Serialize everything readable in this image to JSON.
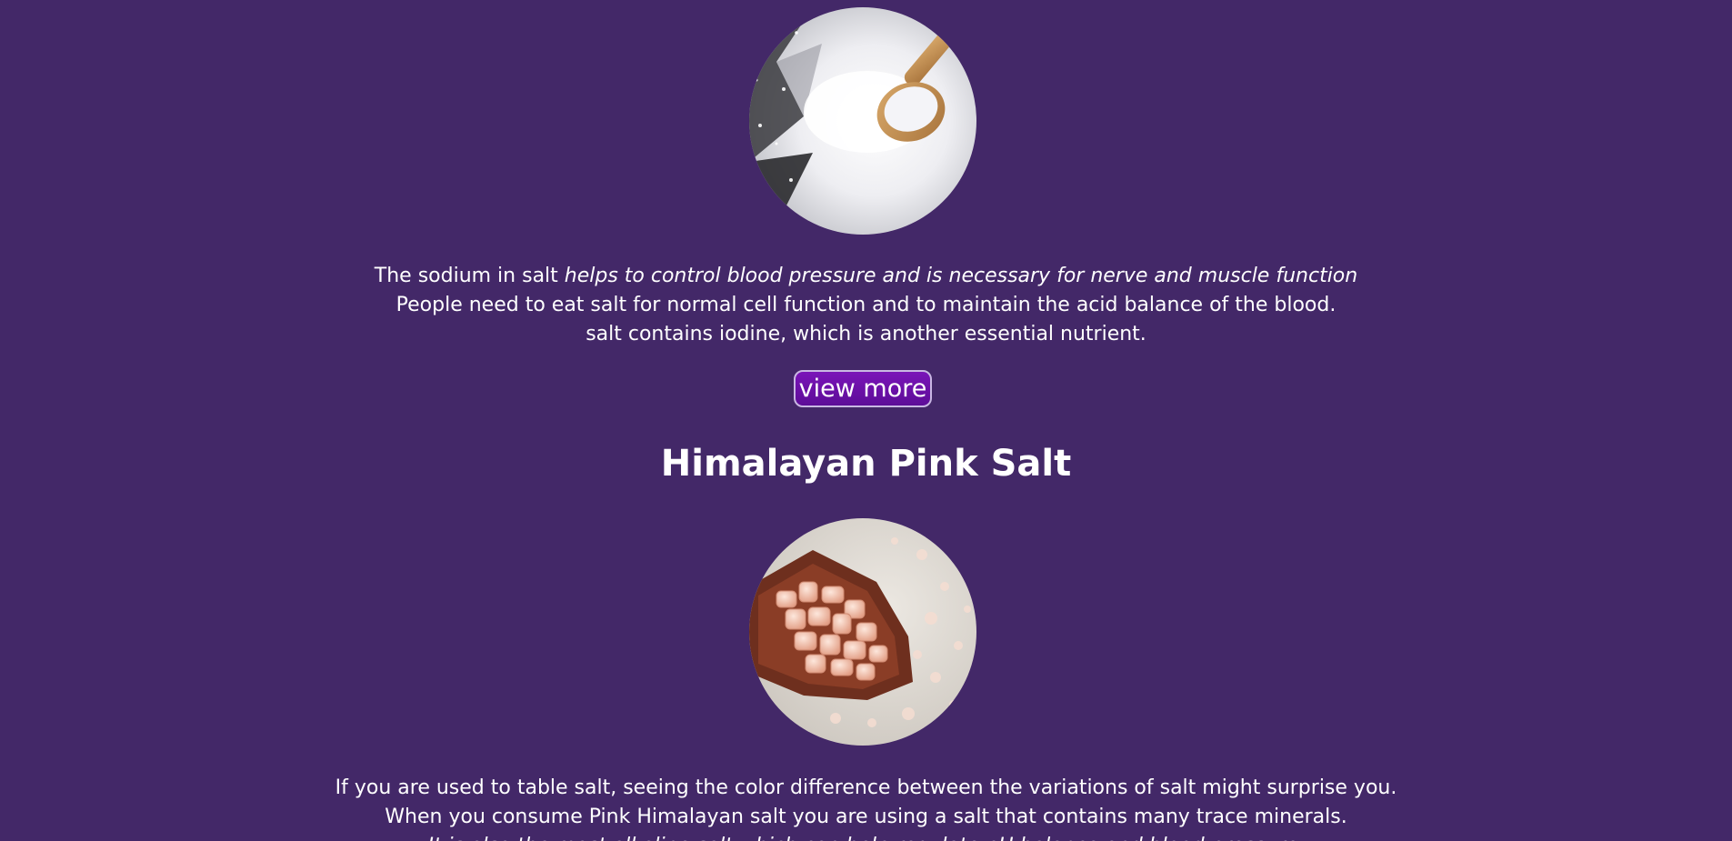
{
  "colors": {
    "background": "#432868",
    "text": "#ffffff",
    "button_fill": "#6a10a8",
    "button_border": "#c9b7e3"
  },
  "table_salt": {
    "image_icon": "table-salt-photo",
    "line1_plain": "The sodium in salt ",
    "line1_italic": "helps to control blood pressure and is necessary for nerve and muscle function",
    "line2": "People need to eat salt for normal cell function and to maintain the acid balance of the blood.",
    "line3": "salt contains iodine, which is another essential nutrient.",
    "button_label": "view more"
  },
  "pink_salt": {
    "heading": "Himalayan Pink Salt",
    "image_icon": "pink-salt-photo",
    "line1": "If you are used to table salt, seeing the color difference between the variations of salt might surprise you.",
    "line2": "When you consume Pink Himalayan salt you are using a salt that contains many trace minerals.",
    "line3": "It is also the most alkaline salt which can help regulate pH balance and blood pressure."
  }
}
